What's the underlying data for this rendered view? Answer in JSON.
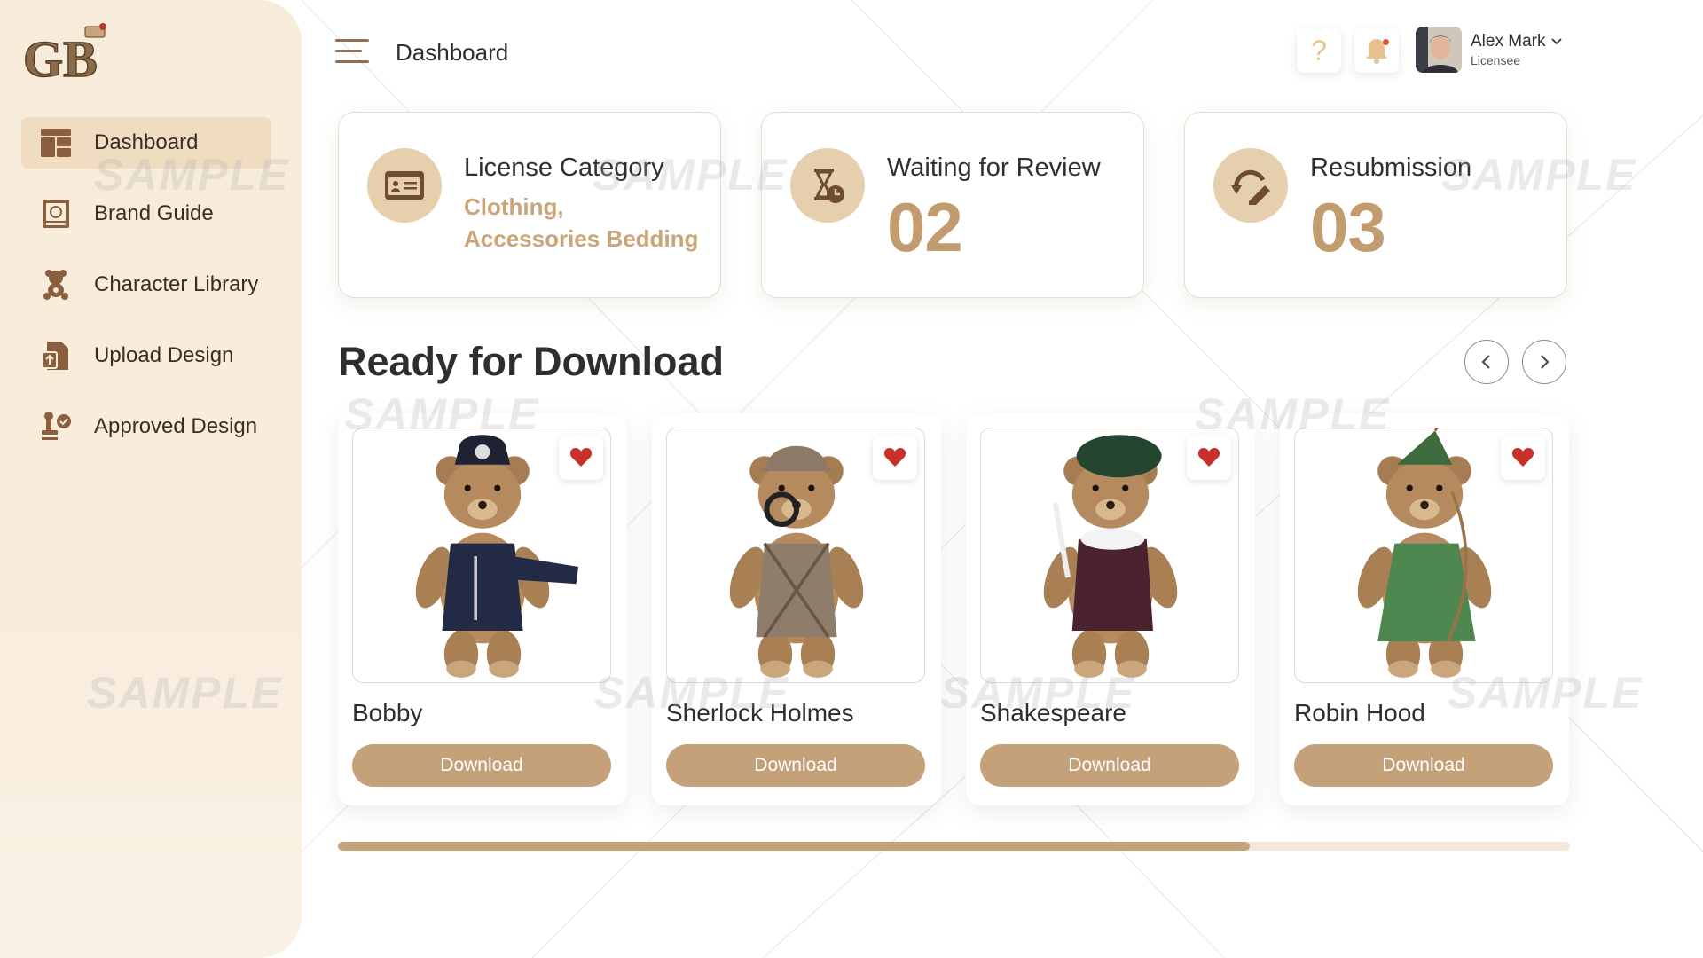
{
  "app": {
    "logo_text": "GB"
  },
  "sidebar": {
    "items": [
      {
        "label": "Dashboard",
        "icon": "dashboard-icon",
        "active": true
      },
      {
        "label": "Brand Guide",
        "icon": "brand-guide-icon",
        "active": false
      },
      {
        "label": "Character Library",
        "icon": "teddy-bear-icon",
        "active": false
      },
      {
        "label": "Upload Design",
        "icon": "upload-file-icon",
        "active": false
      },
      {
        "label": "Approved Design",
        "icon": "approved-stamp-icon",
        "active": false
      }
    ]
  },
  "header": {
    "title": "Dashboard",
    "help_glyph": "?",
    "user": {
      "name": "Alex Mark",
      "role": "Licensee"
    }
  },
  "stats": {
    "license": {
      "title": "License Category",
      "categories": "Clothing, Accessories Bedding"
    },
    "waiting": {
      "title": "Waiting for Review",
      "value": "02"
    },
    "resubmission": {
      "title": "Resubmission",
      "value": "03"
    }
  },
  "section": {
    "title": "Ready for Download"
  },
  "products": [
    {
      "name": "Bobby",
      "button": "Download",
      "outfit": "police"
    },
    {
      "name": "Sherlock Holmes",
      "button": "Download",
      "outfit": "detective"
    },
    {
      "name": "Shakespeare",
      "button": "Download",
      "outfit": "bard"
    },
    {
      "name": "Robin Hood",
      "button": "Download",
      "outfit": "archer"
    }
  ],
  "carousel": {
    "progress_fraction": 0.74
  },
  "watermark": "SAMPLE",
  "colors": {
    "accent": "#c4a179",
    "sidebar_bg": "#f7ebd9",
    "heart": "#c8302b"
  }
}
